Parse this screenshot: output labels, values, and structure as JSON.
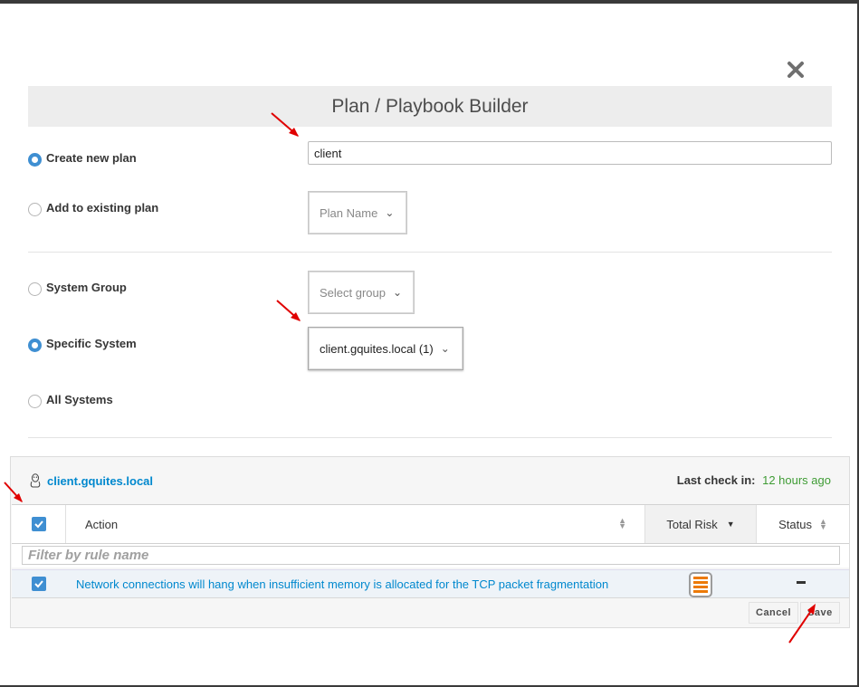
{
  "modal": {
    "title": "Plan / Playbook Builder",
    "close_icon": "close-icon"
  },
  "plan": {
    "create_new_label": "Create new plan",
    "create_new_checked": true,
    "plan_name_value": "client",
    "add_existing_label": "Add to existing plan",
    "add_existing_checked": false,
    "plan_name_dropdown": "Plan Name"
  },
  "target": {
    "system_group_label": "System Group",
    "system_group_checked": false,
    "group_dropdown": "Select group",
    "specific_system_label": "Specific System",
    "specific_system_checked": true,
    "system_dropdown": "client.gquites.local (1)",
    "all_systems_label": "All Systems",
    "all_systems_checked": false
  },
  "system_panel": {
    "system_name": "client.gquites.local",
    "last_checkin_label": "Last check in:",
    "last_checkin_value": "12 hours ago",
    "columns": {
      "action": "Action",
      "total_risk": "Total Risk",
      "status": "Status"
    },
    "filter_placeholder": "Filter by rule name",
    "rows": [
      {
        "checked": true,
        "action": "Network connections will hang when insufficient memory is allocated for the TCP packet fragmentation",
        "risk_icon": "risk-level-icon",
        "status": "–"
      }
    ]
  },
  "buttons": {
    "cancel": "Cancel",
    "save": "Save"
  },
  "colors": {
    "accent": "#3f8fd2",
    "link": "#0088ce",
    "success": "#3f9c35",
    "risk": "#ec7a08",
    "annotation_arrow": "#e00000"
  }
}
